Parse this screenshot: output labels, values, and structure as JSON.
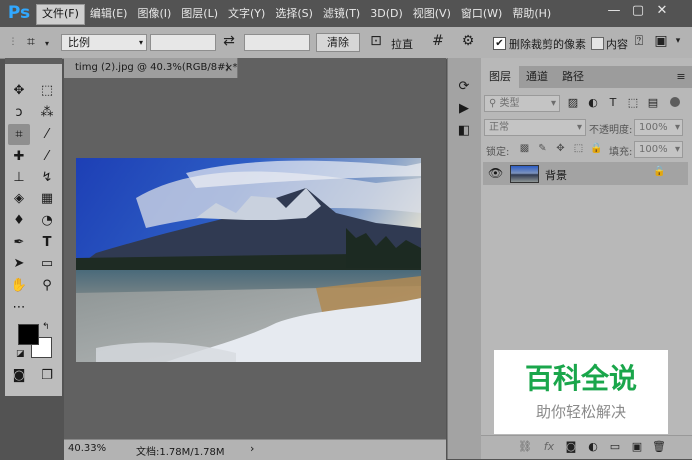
{
  "app": {
    "logo": "Ps"
  },
  "menu": [
    "文件(F)",
    "编辑(E)",
    "图像(I)",
    "图层(L)",
    "文字(Y)",
    "选择(S)",
    "滤镜(T)",
    "3D(D)",
    "视图(V)",
    "窗口(W)",
    "帮助(H)"
  ],
  "window_controls": {
    "minimize": "—",
    "restore": "▢",
    "close": "✕"
  },
  "options": {
    "ratio_select": "比例",
    "swap_symbol": "⇄",
    "clear_label": "清除",
    "straighten_label": "拉直",
    "delete_cropped_label": "删除裁剪的像素",
    "delete_cropped_checked": true,
    "content_aware_label": "内容",
    "content_aware_checked": false
  },
  "document": {
    "tab_title": "timg (2).jpg @ 40.3%(RGB/8#) *",
    "close_symbol": "×",
    "zoom": "40.33%",
    "doc_info": "文档:1.78M/1.78M",
    "status_arrow": "›"
  },
  "layers_panel": {
    "tabs": [
      "图层",
      "通道",
      "路径"
    ],
    "filter_kind": "类型",
    "blend_mode": "正常",
    "opacity_label": "不透明度:",
    "opacity_value": "100%",
    "lock_label": "锁定:",
    "fill_label": "填充:",
    "fill_value": "100%",
    "layers": [
      {
        "name": "背景",
        "visible": true,
        "locked": true
      }
    ]
  },
  "watermark": {
    "title": "百科全说",
    "subtitle": "助你轻松解决",
    "color": "#1aa64b"
  },
  "colors": {
    "foreground": "#000000",
    "background": "#ffffff",
    "accent": "#31a8ff"
  }
}
